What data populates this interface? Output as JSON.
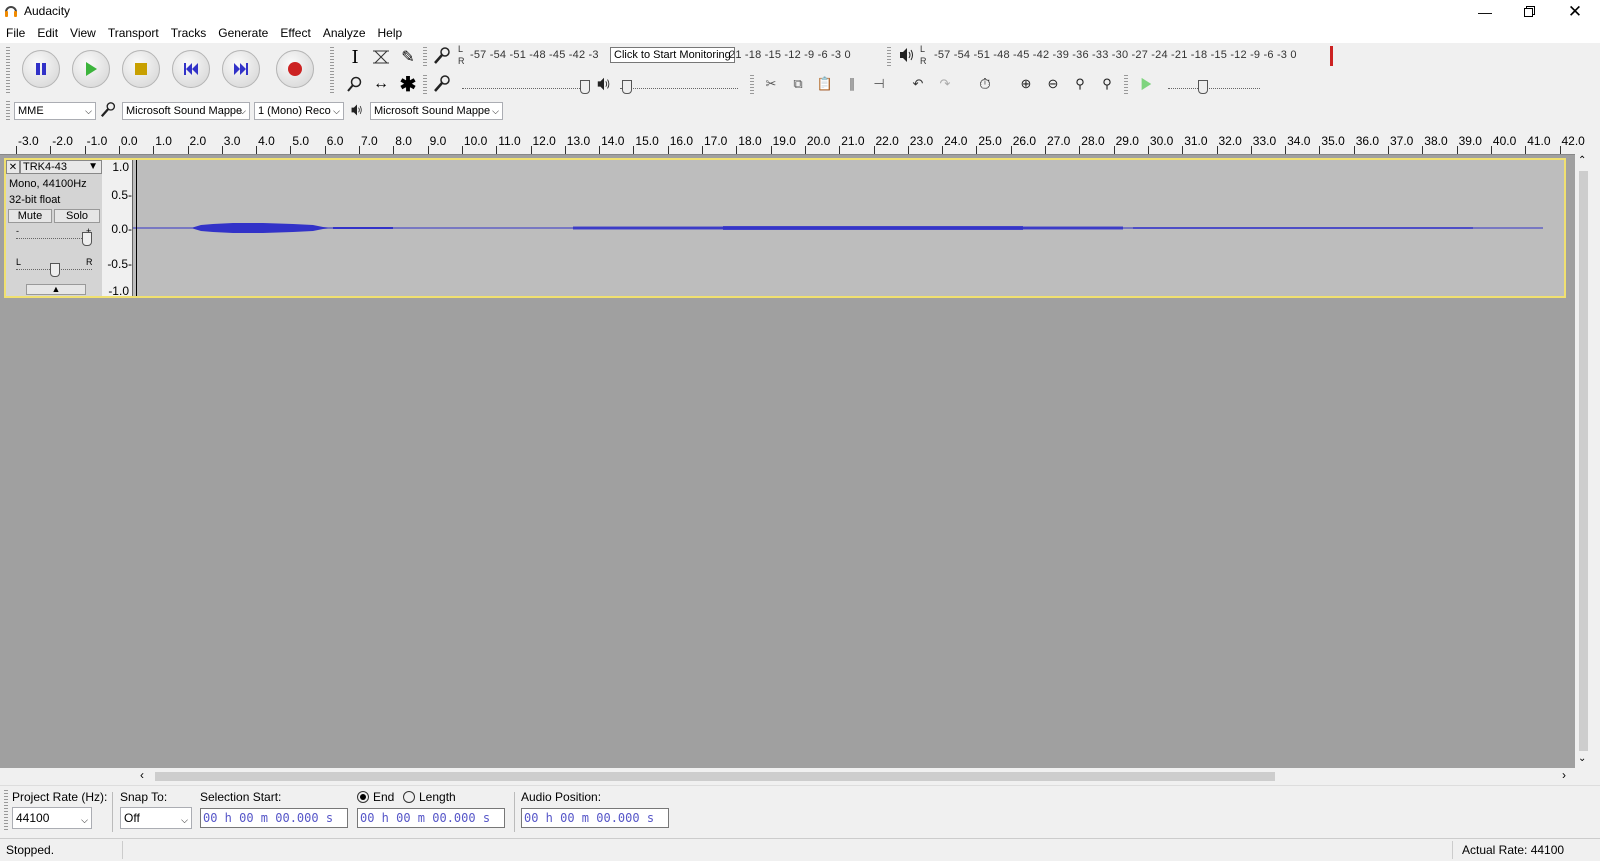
{
  "window": {
    "title": "Audacity"
  },
  "menu": [
    "File",
    "Edit",
    "View",
    "Transport",
    "Tracks",
    "Generate",
    "Effect",
    "Analyze",
    "Help"
  ],
  "meters": {
    "record_scale": "-57 -54 -51 -48 -45 -42 -3",
    "record_scale_tail": "21 -18 -15 -12  -9  -6  -3  0",
    "record_tooltip": "Click to Start Monitoring",
    "play_scale": "-57 -54 -51 -48 -45 -42 -39 -36 -33 -30 -27 -24 -21 -18 -15 -12  -9  -6  -3  0",
    "lr_top": "L",
    "lr_bottom": "R"
  },
  "device": {
    "host": "MME",
    "recording_device": "Microsoft Sound Mappe",
    "channels": "1 (Mono) Reco",
    "playback_device": "Microsoft Sound Mappe"
  },
  "ruler": {
    "labels": [
      "-3.0",
      "-2.0",
      "-1.0",
      "0.0",
      "1.0",
      "2.0",
      "3.0",
      "4.0",
      "5.0",
      "6.0",
      "7.0",
      "8.0",
      "9.0",
      "10.0",
      "11.0",
      "12.0",
      "13.0",
      "14.0",
      "15.0",
      "16.0",
      "17.0",
      "18.0",
      "19.0",
      "20.0",
      "21.0",
      "22.0",
      "23.0",
      "24.0",
      "25.0",
      "26.0",
      "27.0",
      "28.0",
      "29.0",
      "30.0",
      "31.0",
      "32.0",
      "33.0",
      "34.0",
      "35.0",
      "36.0",
      "37.0",
      "38.0",
      "39.0",
      "40.0",
      "41.0",
      "42.0"
    ]
  },
  "track": {
    "name": "TRK4-43",
    "info_line1": "Mono, 44100Hz",
    "info_line2": "32-bit float",
    "mute_label": "Mute",
    "solo_label": "Solo",
    "gain_minus": "-",
    "gain_plus": "+",
    "pan_left": "L",
    "pan_right": "R",
    "vruler": [
      "1.0",
      "0.5-",
      "0.0-",
      "-0.5-",
      "-1.0"
    ],
    "waveform_color": "#3232c8"
  },
  "selection_toolbar": {
    "project_rate_label": "Project Rate (Hz):",
    "project_rate_value": "44100",
    "snap_to_label": "Snap To:",
    "snap_to_value": "Off",
    "selection_start_label": "Selection Start:",
    "selection_start_value": "00 h 00 m 00.000 s",
    "end_label": "End",
    "length_label": "Length",
    "end_value": "00 h 00 m 00.000 s",
    "audio_position_label": "Audio Position:",
    "audio_position_value": "00 h 00 m 00.000 s"
  },
  "status": {
    "state": "Stopped.",
    "actual_rate": "Actual Rate: 44100"
  },
  "colors": {
    "record_red": "#cc2222",
    "play_green": "#3cb43c",
    "transport_blue": "#3232c8",
    "track_border": "#f0e070"
  }
}
